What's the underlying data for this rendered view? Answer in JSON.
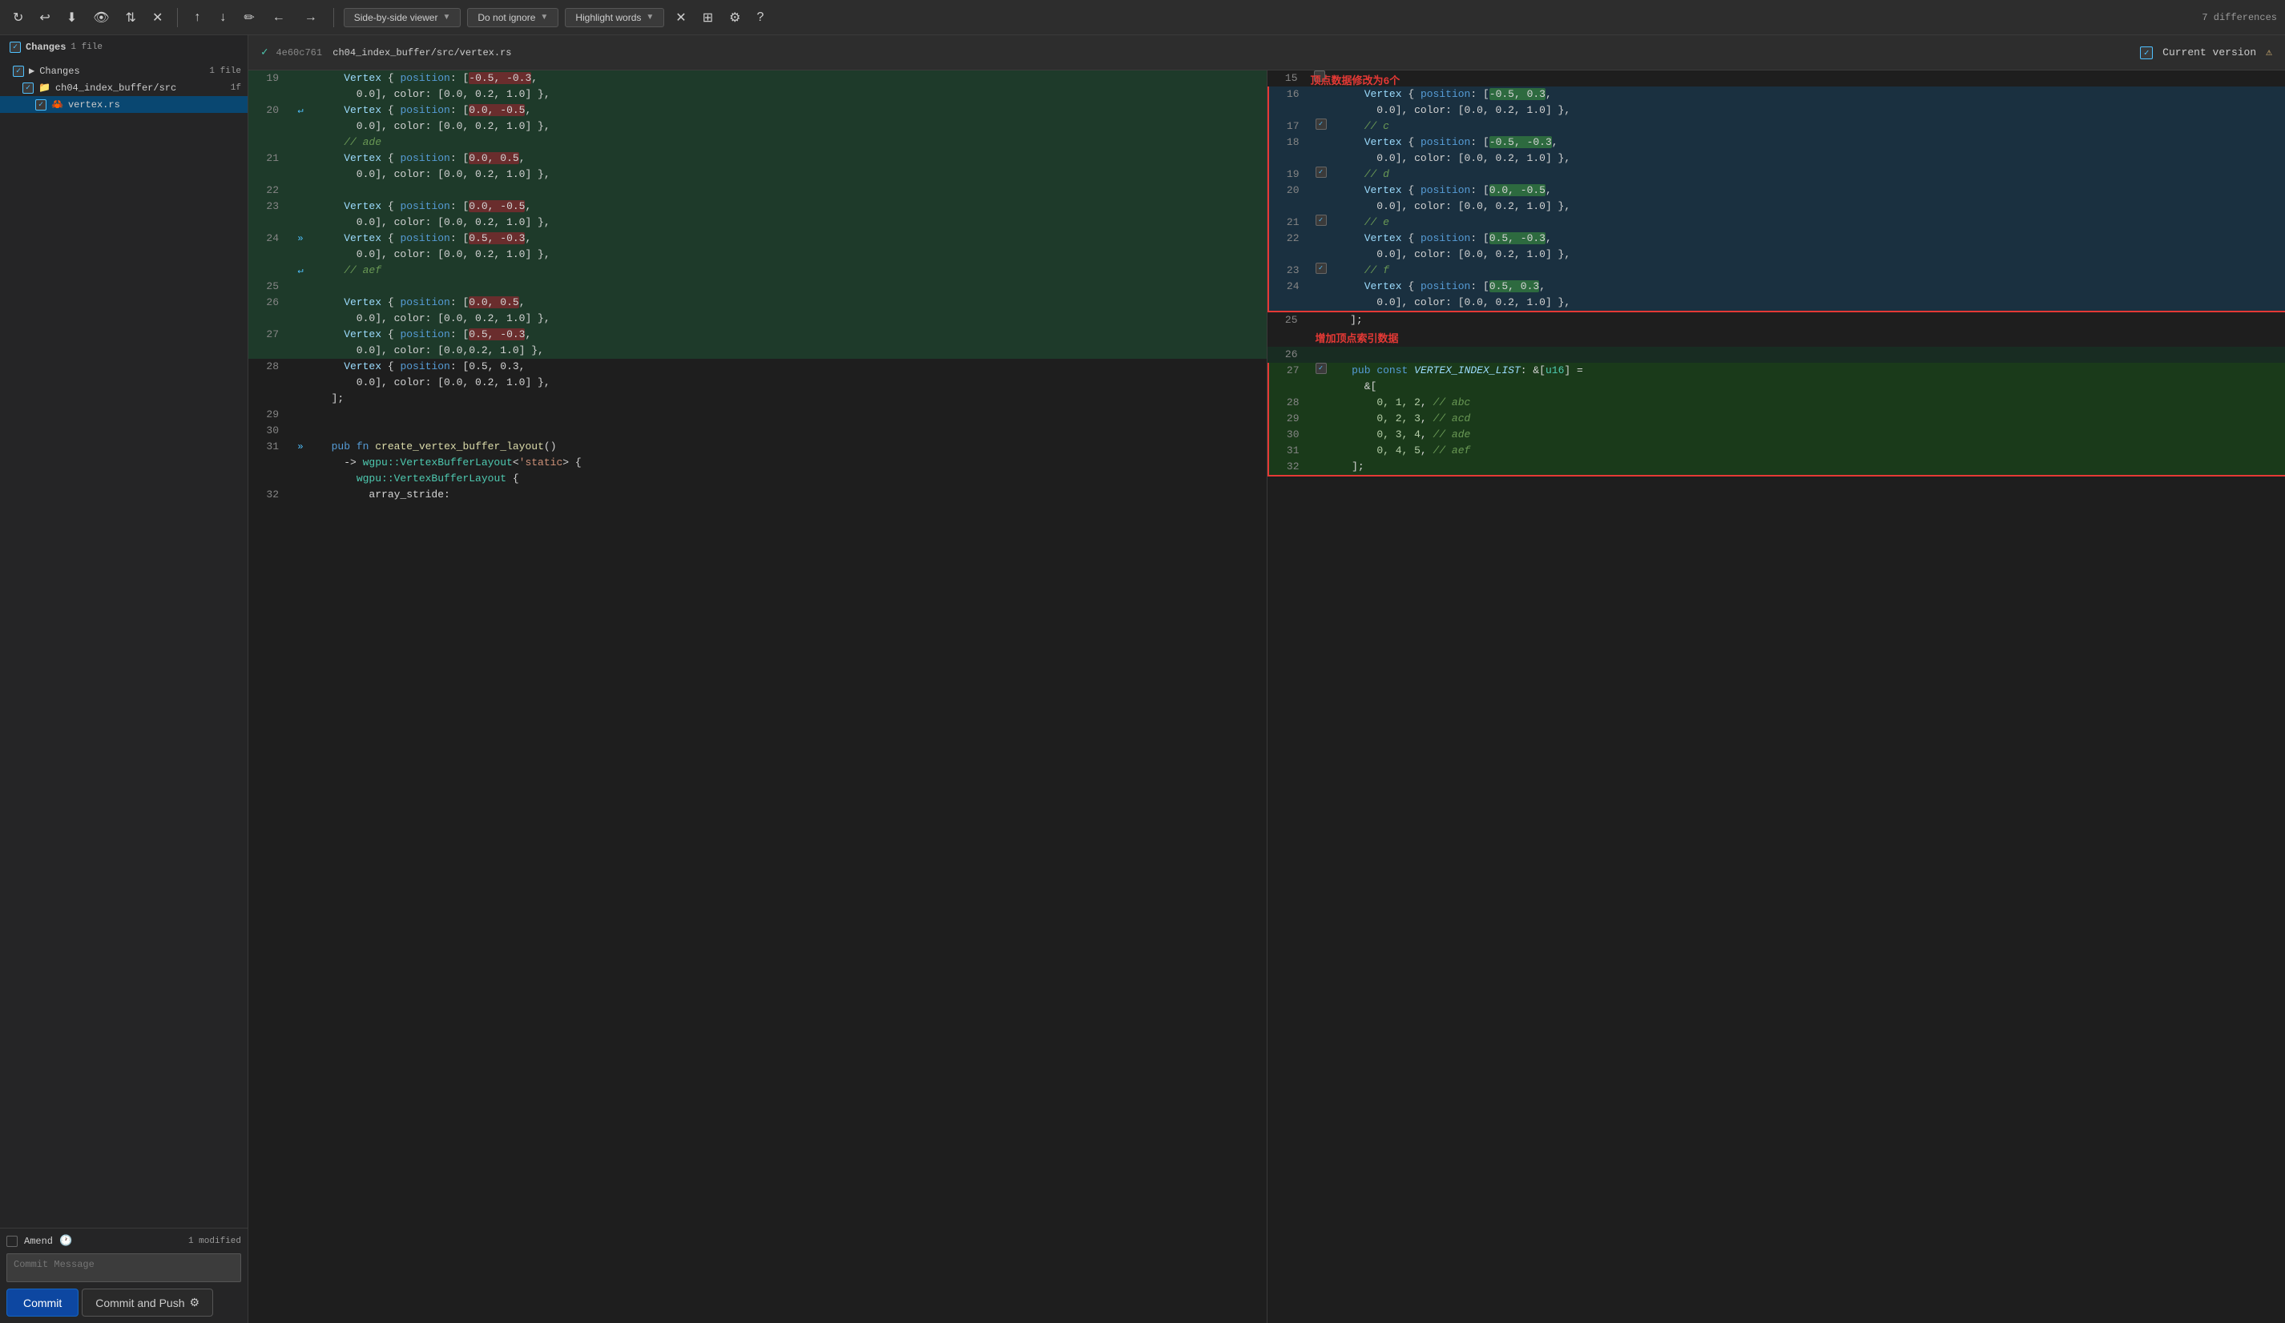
{
  "toolbar": {
    "refresh_icon": "↻",
    "undo_icon": "↩",
    "download_icon": "⬇",
    "eye_icon": "👁",
    "swap_icon": "⇅",
    "close_icon": "✕",
    "nav_up_icon": "↑",
    "nav_down_icon": "↓",
    "edit_icon": "✏",
    "arrow_left_icon": "←",
    "arrow_right_icon": "→",
    "side_by_side_label": "Side-by-side viewer",
    "do_not_ignore_label": "Do not ignore",
    "highlight_words_label": "Highlight words",
    "differences_label": "7 differences",
    "settings_icon": "⚙",
    "help_icon": "?"
  },
  "sidebar": {
    "title": "Changes",
    "file_count": "1 file",
    "tree": [
      {
        "level": 0,
        "checked": true,
        "icon": "▶",
        "label": "Changes",
        "badge": "1 file"
      },
      {
        "level": 1,
        "checked": true,
        "icon": "📁",
        "label": "ch04_index_buffer/src",
        "badge": "1f"
      },
      {
        "level": 2,
        "checked": true,
        "icon": "🦀",
        "label": "vertex.rs",
        "badge": ""
      }
    ]
  },
  "amend": {
    "label": "Amend",
    "clock_icon": "🕐",
    "modified_text": "1 modified"
  },
  "commit_message": {
    "placeholder": "Commit Message"
  },
  "buttons": {
    "commit_label": "Commit",
    "commit_push_label": "Commit and Push",
    "settings_icon": "⚙"
  },
  "diff_header": {
    "hash": "4e60c761",
    "file_path": "ch04_index_buffer/src/vertex.rs",
    "check_icon": "✓",
    "current_version": "Current version",
    "warning_icon": "⚠"
  },
  "left_panel": {
    "lines": [
      {
        "num": 19,
        "content": "    Vertex { position: [-0.5, -0.3,",
        "type": "added"
      },
      {
        "num": "",
        "content": "      0.0], color: [0.0, 0.2, 1.0] },",
        "type": "added"
      },
      {
        "num": 20,
        "content": "    Vertex { position: [0.0, -0.5,",
        "type": "added",
        "has_merge": true
      },
      {
        "num": "",
        "content": "      0.0], color: [0.0, 0.2, 1.0] },",
        "type": "added"
      },
      {
        "num": "",
        "content": "    // ade",
        "type": "added"
      },
      {
        "num": 21,
        "content": "    Vertex { position: [0.0, 0.5,",
        "type": "added"
      },
      {
        "num": 22,
        "content": "",
        "type": "added"
      },
      {
        "num": "",
        "content": "      0.0], color: [0.0, 0.2, 1.0] },",
        "type": "added"
      },
      {
        "num": 23,
        "content": "    Vertex { position: [0.0, -0.5,",
        "type": "added"
      },
      {
        "num": "",
        "content": "      0.0], color: [0.0, 0.2, 1.0] },",
        "type": "added"
      },
      {
        "num": 24,
        "content": "    Vertex { position: [0.5, -0.3,",
        "type": "added",
        "has_merge": true
      },
      {
        "num": "",
        "content": "      0.0], color: [0.0, 0.2, 1.0] },",
        "type": "added"
      },
      {
        "num": "",
        "content": "    // aef",
        "type": "added",
        "has_merge2": true
      },
      {
        "num": 25,
        "content": "",
        "type": "added"
      },
      {
        "num": 26,
        "content": "    Vertex { position: [0.0, 0.5,",
        "type": "added"
      },
      {
        "num": "",
        "content": "      0.0], color: [0.0, 0.2, 1.0] },",
        "type": "added"
      },
      {
        "num": 27,
        "content": "    Vertex { position: [0.5, -0.3,",
        "type": "added"
      },
      {
        "num": "",
        "content": "      0.0], color: [0.0,0.2, 1.0] },",
        "type": "added"
      },
      {
        "num": 28,
        "content": "    Vertex { position: [0.5, 0.3,",
        "type": "normal"
      },
      {
        "num": "",
        "content": "      0.0], color: [0.0, 0.2, 1.0] },",
        "type": "normal"
      },
      {
        "num": "",
        "content": "  ];",
        "type": "normal"
      },
      {
        "num": 29,
        "content": "",
        "type": "normal"
      },
      {
        "num": 30,
        "content": "",
        "type": "normal"
      },
      {
        "num": 31,
        "content": "  pub fn create_vertex_buffer_layout()",
        "type": "normal",
        "has_merge": true
      },
      {
        "num": "",
        "content": "    -> wgpu::VertexBufferLayout<'static> {",
        "type": "normal"
      },
      {
        "num": "",
        "content": "      wgpu::VertexBufferLayout {",
        "type": "normal"
      },
      {
        "num": 32,
        "content": "        array_stride:",
        "type": "normal"
      }
    ]
  },
  "right_panel": {
    "annotation1": "顶点数据修改为6个",
    "annotation2": "增加顶点索引数据",
    "lines": [
      {
        "num": 15,
        "content": "",
        "type": "blank",
        "checkbox": false
      },
      {
        "num": 16,
        "content": "    Vertex { position: [-0.5, 0.3,",
        "type": "modified",
        "checkbox": false
      },
      {
        "num": "",
        "content": "      0.0], color: [0.0, 0.2, 1.0] },",
        "type": "modified",
        "checkbox": false
      },
      {
        "num": 17,
        "content": "    // c",
        "type": "modified",
        "checkbox": true
      },
      {
        "num": 18,
        "content": "    Vertex { position: [-0.5, -0.3,",
        "type": "modified",
        "checkbox": false
      },
      {
        "num": "",
        "content": "      0.0], color: [0.0, 0.2, 1.0] },",
        "type": "modified",
        "checkbox": false
      },
      {
        "num": 19,
        "content": "    // d",
        "type": "modified",
        "checkbox": true
      },
      {
        "num": 20,
        "content": "    Vertex { position: [0.0, -0.5,",
        "type": "modified",
        "checkbox": false
      },
      {
        "num": "",
        "content": "      0.0], color: [0.0, 0.2, 1.0] },",
        "type": "modified",
        "checkbox": false
      },
      {
        "num": 21,
        "content": "    // e",
        "type": "modified",
        "checkbox": true
      },
      {
        "num": 22,
        "content": "    Vertex { position: [0.5, -0.3,",
        "type": "modified",
        "checkbox": false
      },
      {
        "num": "",
        "content": "      0.0], color: [0.0, 0.2, 1.0] },",
        "type": "modified",
        "checkbox": false
      },
      {
        "num": 23,
        "content": "    // f",
        "type": "modified",
        "checkbox": true
      },
      {
        "num": 24,
        "content": "    Vertex { position: [0.5, 0.3,",
        "type": "modified",
        "checkbox": false
      },
      {
        "num": "",
        "content": "      0.0], color: [0.0, 0.2, 1.0] },",
        "type": "modified",
        "checkbox": false
      },
      {
        "num": 25,
        "content": "  ];",
        "type": "normal",
        "checkbox": false
      },
      {
        "num": 26,
        "content": "",
        "type": "blank_green",
        "checkbox": false
      },
      {
        "num": 27,
        "content": "  pub const VERTEX_INDEX_LIST: &[u16] =",
        "type": "new_added",
        "checkbox": true
      },
      {
        "num": "",
        "content": "    &[",
        "type": "new_added",
        "checkbox": false
      },
      {
        "num": 28,
        "content": "      0, 1, 2, // abc",
        "type": "new_added",
        "checkbox": false
      },
      {
        "num": 29,
        "content": "      0, 2, 3, // acd",
        "type": "new_added",
        "checkbox": false
      },
      {
        "num": 30,
        "content": "      0, 3, 4, // ade",
        "type": "new_added",
        "checkbox": false
      },
      {
        "num": 31,
        "content": "      0, 4, 5, // aef",
        "type": "new_added",
        "checkbox": false
      },
      {
        "num": 32,
        "content": "  ];",
        "type": "new_added",
        "checkbox": false
      }
    ]
  }
}
